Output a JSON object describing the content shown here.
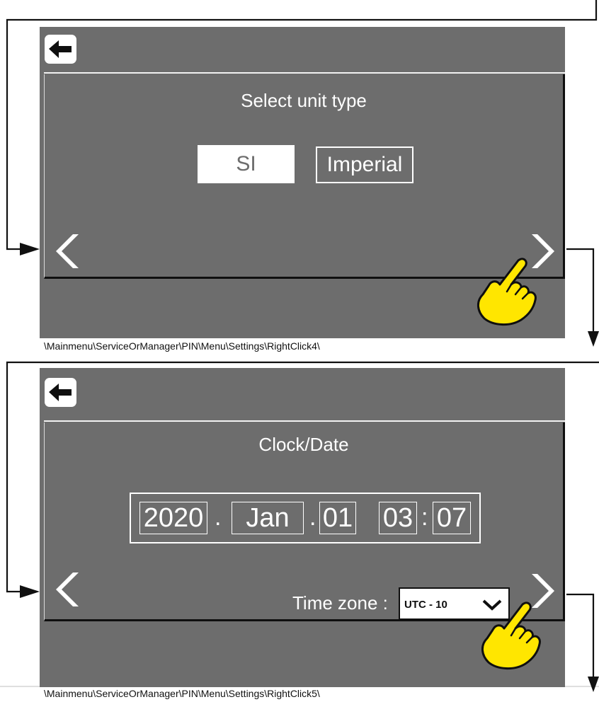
{
  "screen1": {
    "title": "Select unit type",
    "options": [
      "SI",
      "Imperial"
    ],
    "selected": "SI",
    "path": "\\Mainmenu\\ServiceOrManager\\PIN\\Menu\\Settings\\RightClick4\\"
  },
  "screen2": {
    "title": "Clock/Date",
    "year": "2020",
    "month": "Jan",
    "day": "01",
    "hour": "03",
    "minute": "07",
    "date_separator": ".",
    "time_separator": ":",
    "timezone_label": "Time zone :",
    "timezone_value": "UTC - 10",
    "path": "\\Mainmenu\\ServiceOrManager\\PIN\\Menu\\Settings\\RightClick5\\"
  },
  "icons": {
    "back": "back-arrow-icon",
    "prev": "chevron-left-icon",
    "next": "chevron-right-icon",
    "pointer": "pointing-hand-icon",
    "dropdown": "chevron-down-icon"
  },
  "colors": {
    "screen_bg": "#6d6d6d",
    "foreground": "#ffffff",
    "hand_fill": "#ffe600",
    "line": "#0f0f0f"
  }
}
